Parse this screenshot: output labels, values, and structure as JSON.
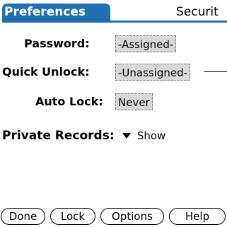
{
  "titlebar": {
    "app_title": "Preferences",
    "panel_label": "Securit"
  },
  "form": {
    "password": {
      "label": "Password:",
      "value": "-Assigned-"
    },
    "quick_unlock": {
      "label": "Quick Unlock:",
      "value": "-Unassigned-"
    },
    "auto_lock": {
      "label": "Auto Lock:",
      "value": "Never"
    }
  },
  "private_records": {
    "label": "Private Records:",
    "value": "Show",
    "icon": "triangle-down-icon"
  },
  "buttons": {
    "done": "Done",
    "lock": "Lock",
    "options": "Options",
    "help": "Help"
  },
  "colors": {
    "title_accent": "#1f6fb1",
    "field_background": "#d9d9d9"
  }
}
